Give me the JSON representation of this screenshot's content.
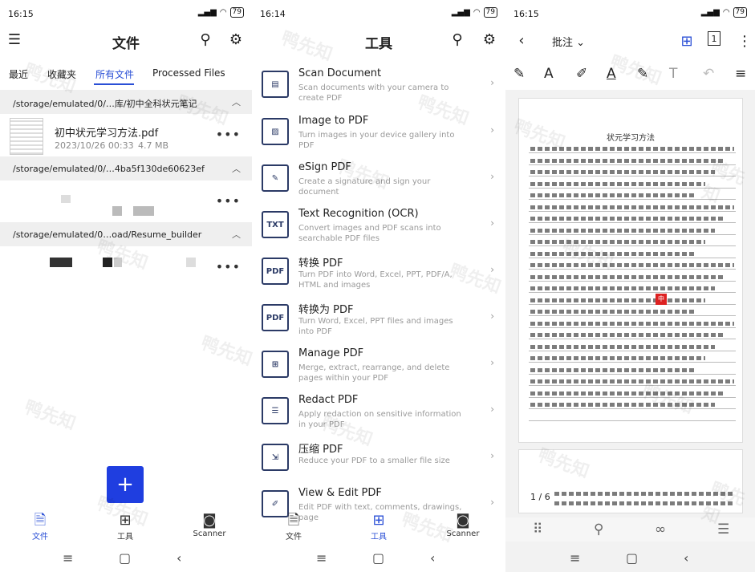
{
  "screens": [
    {
      "status": {
        "time": "16:15",
        "battery": "79"
      },
      "title": "文件",
      "tabs": [
        "最近",
        "收藏夹",
        "所有文件",
        "Processed Files"
      ],
      "folders": [
        {
          "path": "/storage/emulated/0/…库/初中全科状元笔记"
        },
        {
          "path": "/storage/emulated/0/…4ba5f130de60623ef"
        },
        {
          "path": "/storage/emulated/0…oad/Resume_builder"
        }
      ],
      "file": {
        "name": "初中状元学习方法.pdf",
        "date": "2023/10/26 00:33",
        "size": "4.7 MB"
      },
      "fab": "+",
      "nav": [
        {
          "label": "文件",
          "icon": "file-icon"
        },
        {
          "label": "工具",
          "icon": "tools-icon"
        },
        {
          "label": "Scanner",
          "icon": "camera-icon"
        }
      ]
    },
    {
      "status": {
        "time": "16:14",
        "battery": "79"
      },
      "title": "工具",
      "tools": [
        {
          "title": "Scan Document",
          "desc": "Scan documents with your camera to create PDF",
          "icon": "scan-icon",
          "glyph": "▤"
        },
        {
          "title": "Image to PDF",
          "desc": "Turn images in your device gallery into PDF",
          "icon": "image-icon",
          "glyph": "▨"
        },
        {
          "title": "eSign PDF",
          "desc": "Create a signature and sign your document",
          "icon": "signature-icon",
          "glyph": "✎"
        },
        {
          "title": "Text Recognition (OCR)",
          "desc": "Convert images and PDF scans into searchable PDF files",
          "icon": "ocr-icon",
          "glyph": "TXT"
        },
        {
          "title": "转换 PDF",
          "desc": "Turn PDF into Word, Excel, PPT, PDF/A, HTML and images",
          "icon": "convert-from-pdf-icon",
          "glyph": "PDF"
        },
        {
          "title": "转换为 PDF",
          "desc": "Turn Word, Excel, PPT files and images into PDF",
          "icon": "convert-to-pdf-icon",
          "glyph": "PDF"
        },
        {
          "title": "Manage PDF",
          "desc": "Merge, extract, rearrange, and delete pages within your PDF",
          "icon": "manage-icon",
          "glyph": "⊞"
        },
        {
          "title": "Redact PDF",
          "desc": "Apply redaction on sensitive information in your PDF",
          "icon": "redact-icon",
          "glyph": "☰"
        },
        {
          "title": "压缩 PDF",
          "desc": "Reduce your PDF to a smaller file size",
          "icon": "compress-icon",
          "glyph": "⇲"
        },
        {
          "title": "View & Edit PDF",
          "desc": "Edit PDF with text, comments, drawings, page",
          "icon": "edit-icon",
          "glyph": "✐"
        }
      ],
      "nav": [
        {
          "label": "文件",
          "icon": "file-icon"
        },
        {
          "label": "工具",
          "icon": "tools-icon"
        },
        {
          "label": "Scanner",
          "icon": "camera-icon"
        }
      ]
    },
    {
      "status": {
        "time": "16:15",
        "battery": "79"
      },
      "mode": "批注",
      "page_count_badge": "1",
      "doc_title": "状元学习方法",
      "page_indicator": "1 / 6",
      "stamp": "中"
    }
  ],
  "watermark": "鸭先知"
}
